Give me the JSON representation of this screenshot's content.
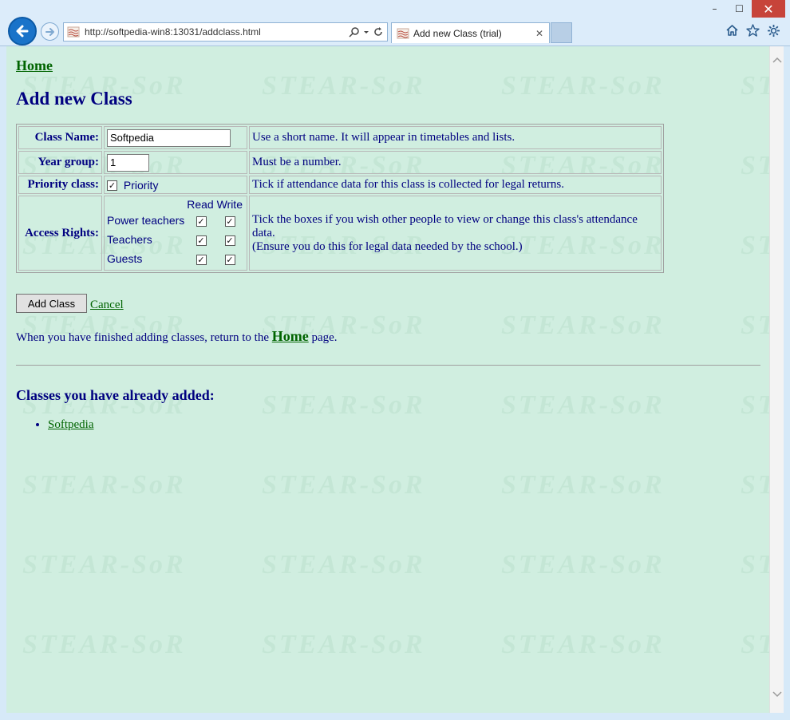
{
  "browser": {
    "url": "http://softpedia-win8:13031/addclass.html",
    "tab_title": "Add new Class (trial)",
    "window_controls": {
      "minimize": "–",
      "maximize": "☐",
      "close": "✕"
    },
    "icons": [
      "back-arrow-icon",
      "forward-arrow-icon",
      "search-icon",
      "refresh-icon",
      "home-icon",
      "favorites-star-icon",
      "settings-gear-icon"
    ]
  },
  "page": {
    "home_link": "Home",
    "title": "Add new Class",
    "form": {
      "class_name": {
        "label": "Class Name:",
        "value": "Softpedia",
        "help": "Use a short name. It will appear in timetables and lists."
      },
      "year_group": {
        "label": "Year group:",
        "value": "1",
        "help": "Must be a number."
      },
      "priority": {
        "label": "Priority class:",
        "checkbox_label": "Priority",
        "checked": true,
        "help": "Tick if attendance data for this class is collected for legal returns."
      },
      "access_rights": {
        "label": "Access Rights:",
        "col_read": "Read",
        "col_write": "Write",
        "rows": [
          {
            "name": "Power teachers",
            "read": true,
            "write": true
          },
          {
            "name": "Teachers",
            "read": true,
            "write": true
          },
          {
            "name": "Guests",
            "read": true,
            "write": true
          }
        ],
        "help_line1": "Tick the boxes if you wish other people to view or change this class's attendance data.",
        "help_line2": "(Ensure you do this for legal data needed by the school.)"
      }
    },
    "add_button": "Add Class",
    "cancel_link": "Cancel",
    "finish_note_before": "When you have finished adding classes, return to the",
    "finish_note_link": "Home",
    "finish_note_after": "page.",
    "added_heading": "Classes you have already added:",
    "added_classes": [
      "Softpedia"
    ],
    "watermark_text": "STEAR-SoR"
  },
  "colors": {
    "page_bg": "#d0eee0",
    "heading": "#000080",
    "link": "#006400"
  }
}
